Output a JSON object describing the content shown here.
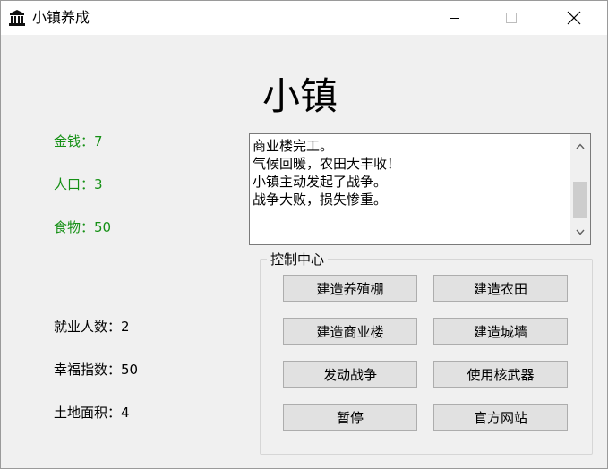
{
  "window": {
    "title": "小镇养成"
  },
  "heading": "小镇",
  "stats": {
    "money": "金钱：7",
    "population": "人口：3",
    "food": "食物：50",
    "employed": "就业人数：2",
    "happiness": "幸福指数：50",
    "land": "土地面积：4"
  },
  "log": {
    "lines": [
      "商业楼完工。",
      "气候回暖，农田大丰收！",
      "小镇主动发起了战争。",
      "战争大败，损失惨重。"
    ]
  },
  "control": {
    "label": "控制中心",
    "buttons": {
      "build_farm_shed": "建造养殖棚",
      "build_farmland": "建造农田",
      "build_commercial": "建造商业楼",
      "build_wall": "建造城墙",
      "start_war": "发动战争",
      "use_nuke": "使用核武器",
      "pause": "暂停",
      "website": "官方网站"
    }
  },
  "colors": {
    "stat_green": "#159015",
    "window_bg": "#f0f0f0",
    "button_bg": "#e1e1e1"
  },
  "icons": {
    "app": "building-icon",
    "minimize": "minimize-icon",
    "maximize": "maximize-icon",
    "close": "close-icon",
    "scroll_up": "chevron-up-icon",
    "scroll_down": "chevron-down-icon"
  }
}
